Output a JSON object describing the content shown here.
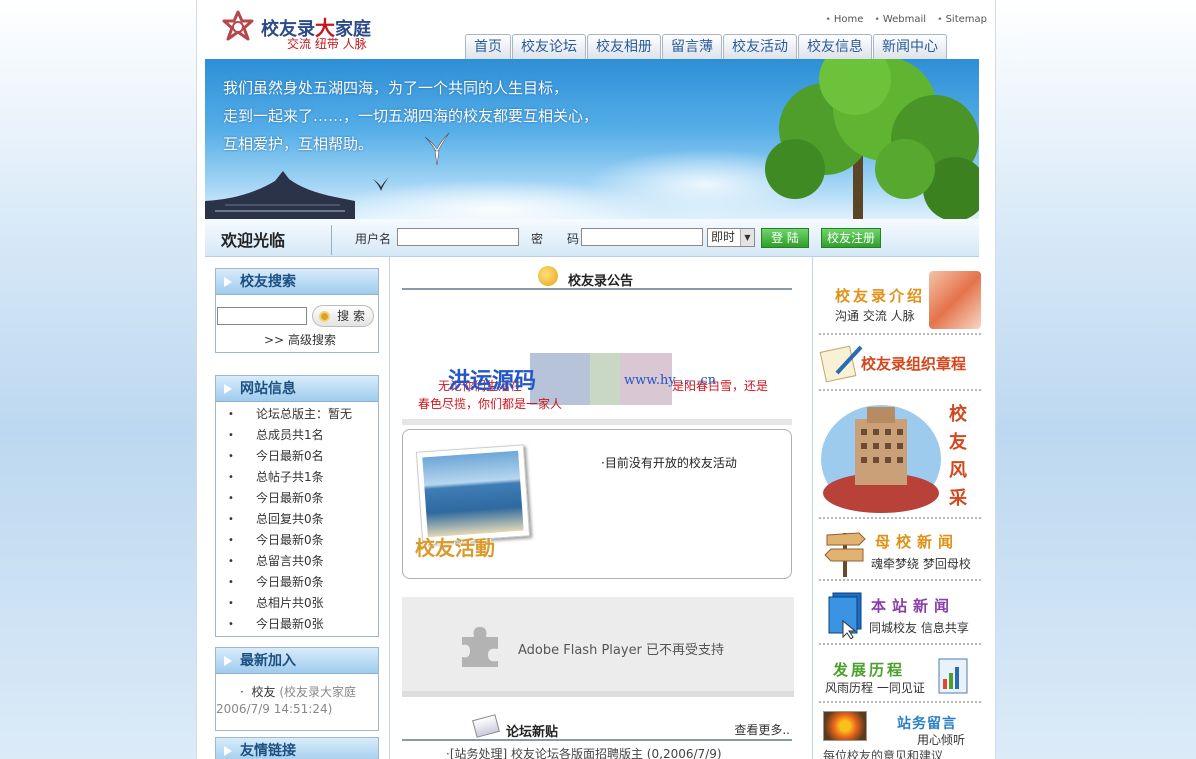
{
  "logo": {
    "name_a": "校友录",
    "name_big": "大",
    "name_b": "家庭",
    "slogan": "交流 纽带 人脉"
  },
  "toplinks": [
    "Home",
    "Webmail",
    "Sitemap"
  ],
  "nav": [
    "首页",
    "校友论坛",
    "校友相册",
    "留言薄",
    "校友活动",
    "校友信息",
    "新闻中心"
  ],
  "banner": {
    "line1": "我们虽然身处五湖四海，为了一个共同的人生目标，",
    "line2": "走到一起来了……，一切五湖四海的校友都要互相关心，",
    "line3": "互相爱护，互相帮助。"
  },
  "login": {
    "welcome": "欢迎光临",
    "user_label": "用户名",
    "pass_label_a": "密",
    "pass_label_b": "码",
    "mode": "即时",
    "login_btn": "登 陆",
    "register_btn": "校友注册"
  },
  "search_box": {
    "title": "校友搜索",
    "button": "搜 索",
    "advanced": "高级搜索"
  },
  "site_info": {
    "title": "网站信息",
    "items": [
      "论坛总版主：暂无",
      "总成员共1名",
      "今日最新0名",
      "总帖子共1条",
      "今日最新0条",
      "总回复共0条",
      "今日最新0条",
      "总留言共0条",
      "今日最新0条",
      "总相片共0张",
      "今日最新0张"
    ]
  },
  "latest": {
    "title": "最新加入",
    "name": "校友",
    "detail": "(校友录大家庭",
    "date": "2006/7/9 14:51:24)"
  },
  "friends": {
    "title": "友情链接"
  },
  "notice": {
    "title": "校友录公告",
    "text_a": "无论你们生活在",
    "text_b": "是阳春白雪，还是",
    "text_c": "春色尽揽，你们都是一家人",
    "watermark_cn": "洪运源码",
    "watermark_url": "www.hy  ... .cn"
  },
  "activity": {
    "caption": "校友活動",
    "message": "·目前没有开放的校友活动"
  },
  "flash": {
    "message": "Adobe Flash Player 已不再受支持"
  },
  "forum": {
    "title": "论坛新贴",
    "more": "查看更多..",
    "post": "·[站务处理] 校友论坛各版面招聘版主 (0,2006/7/9)"
  },
  "right": {
    "intro_main": "校友录介绍",
    "intro_sub": "沟通 交流 人脉",
    "charter_main": "校友录组织章程",
    "style_main": "校友风采",
    "school_news_main": "母校新闻",
    "school_news_sub": "魂牵梦绕 梦回母校",
    "site_news_main": "本站新闻",
    "site_news_sub": "同城校友 信息共享",
    "history_main": "发展历程",
    "history_sub": "风雨历程 一同见证",
    "board_main": "站务留言",
    "board_sub": "用心倾听",
    "board_sub2": "每位校友的意见和建议"
  },
  "colors": {
    "nav_text": "#2a5b9b",
    "header_blue": "#1d4f82",
    "red": "#c4161c",
    "green_btn": "#2f9e2b"
  }
}
